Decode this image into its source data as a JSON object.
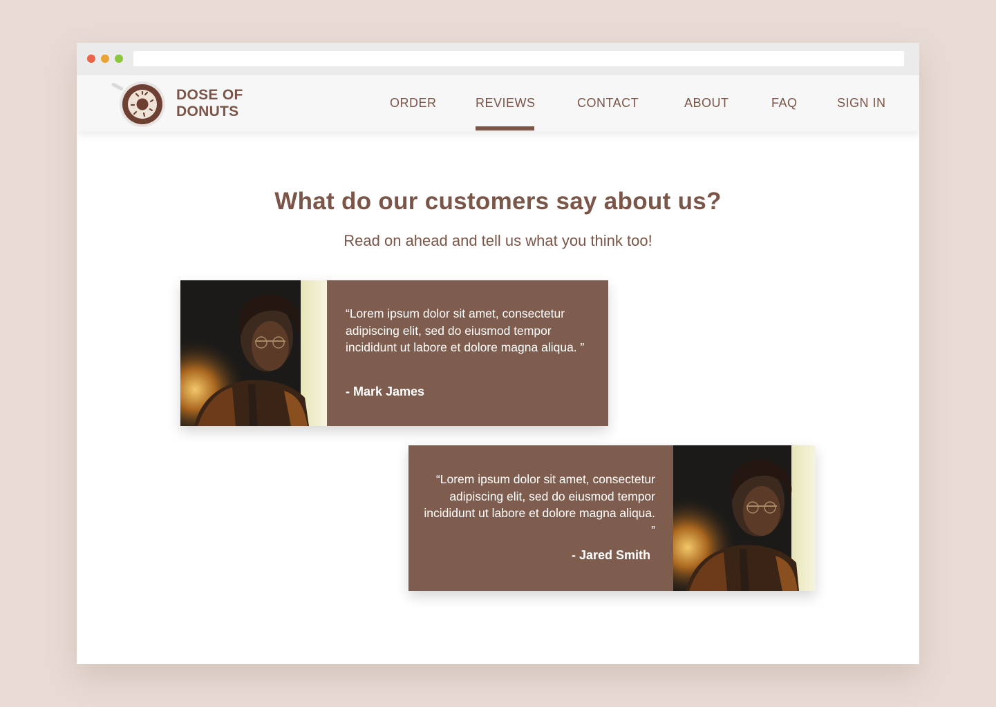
{
  "browser": {
    "controls": [
      "close",
      "minimize",
      "maximize"
    ],
    "url": ""
  },
  "brand": {
    "line1": "DOSE OF",
    "line2": "DONUTS",
    "logo_icon": "donut-icon"
  },
  "nav": {
    "items": [
      {
        "label": "ORDER",
        "active": false
      },
      {
        "label": "REVIEWS",
        "active": true
      },
      {
        "label": "CONTACT",
        "active": false
      },
      {
        "label": "ABOUT",
        "active": false
      },
      {
        "label": "FAQ",
        "active": false
      },
      {
        "label": "SIGN IN",
        "active": false
      }
    ]
  },
  "hero": {
    "headline": "What do our customers say about us?",
    "subheadline": "Read on ahead and tell us what you think too!"
  },
  "reviews": [
    {
      "quote": "“Lorem ipsum dolor sit amet, consectetur adipiscing elit, sed do eiusmod tempor incididunt ut labore et dolore magna aliqua. ”",
      "author": "- Mark James",
      "photo_side": "left"
    },
    {
      "quote": "“Lorem ipsum dolor sit amet, consectetur adipiscing elit, sed do eiusmod tempor incididunt ut labore et dolore magna aliqua.  ”",
      "author": "- Jared Smith",
      "photo_side": "right"
    }
  ],
  "colors": {
    "page_background": "#e8dbd5",
    "brand_brown": "#7a5548",
    "card_brown": "#7e5d4f",
    "nav_background": "#f7f7f7"
  }
}
